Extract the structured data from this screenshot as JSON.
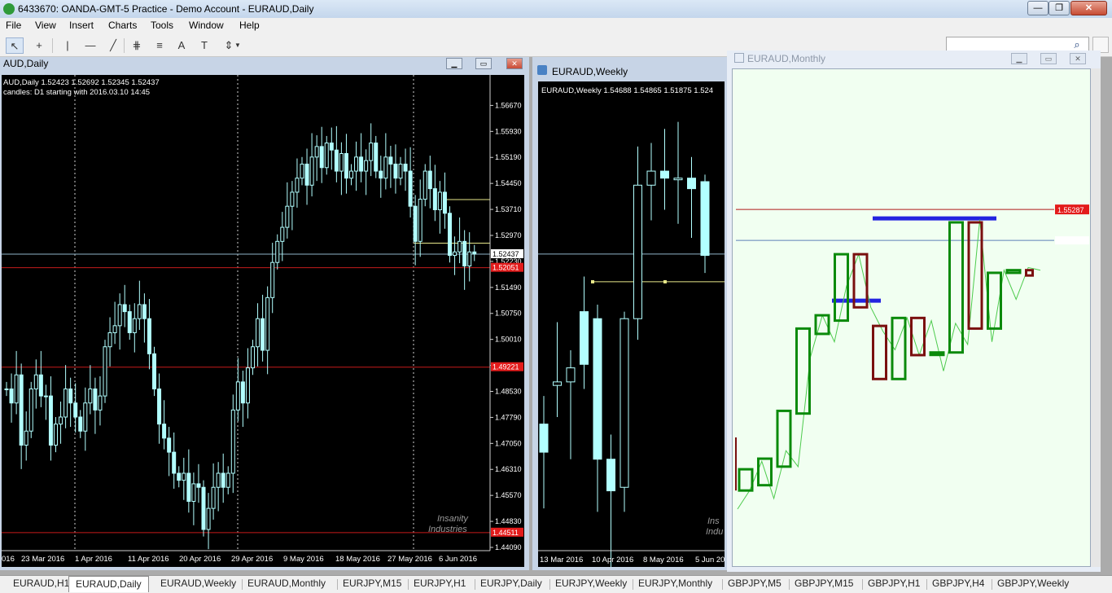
{
  "app": {
    "title": "6433670: OANDA-GMT-5 Practice - Demo Account - EURAUD,Daily",
    "icon": "app-logo-icon",
    "window_buttons": {
      "min": "—",
      "max": "❐",
      "close": "✕"
    }
  },
  "menu": [
    "File",
    "View",
    "Insert",
    "Charts",
    "Tools",
    "Window",
    "Help"
  ],
  "toolbar": {
    "icons": [
      "cursor-icon",
      "crosshair-icon",
      "vertical-line-icon",
      "horizontal-line-icon",
      "trend-line-icon",
      "fibonacci-channel-icon",
      "fibonacci-retracement-icon",
      "text-icon",
      "text-label-icon",
      "arrows-icon"
    ],
    "glyphs": [
      "↖",
      "+",
      "|",
      "—",
      "╱",
      "⋕",
      "≡",
      "A",
      "T",
      "⇕"
    ],
    "search_placeholder": ""
  },
  "windows": {
    "daily": {
      "title": "AUD,Daily",
      "ohlc_line": "AUD,Daily  1.52423 1.52692 1.52345 1.52437",
      "info_line": "candles: D1 starting with 2016.03.10 14:45",
      "watermark_1": "Insanity",
      "watermark_2": "Industries"
    },
    "weekly": {
      "title": "EURAUD,Weekly",
      "ohlc_line": "EURAUD,Weekly  1.54688 1.54865 1.51875 1.524",
      "watermark_1": "Ins",
      "watermark_2": "Indu"
    },
    "monthly": {
      "title": "EURAUD,Monthly",
      "price_label": "1.55287"
    }
  },
  "chart_data": [
    {
      "type": "candlestick",
      "title": "EURAUD,Daily",
      "ylim": [
        1.4409,
        1.5712
      ],
      "y_ticks": [
        "1.56670",
        "1.55930",
        "1.55190",
        "1.54450",
        "1.53710",
        "1.52970",
        "1.52230",
        "1.51490",
        "1.50750",
        "1.50010",
        "1.49270",
        "1.48530",
        "1.47790",
        "1.47050",
        "1.46310",
        "1.45570",
        "1.44830",
        "1.44090"
      ],
      "x_ticks": [
        "016",
        "23 Mar 2016",
        "1 Apr 2016",
        "11 Apr 2016",
        "20 Apr 2016",
        "29 Apr 2016",
        "9 May 2016",
        "18 May 2016",
        "27 May 2016",
        "6 Jun 2016"
      ],
      "price_labels": [
        {
          "value": 1.52437,
          "label": "1.52437",
          "kind": "bid"
        },
        {
          "value": 1.5205,
          "label": "1.52051",
          "kind": "level"
        },
        {
          "value": 1.49221,
          "label": "1.49221",
          "kind": "level"
        },
        {
          "value": 1.44511,
          "label": "1.44511",
          "kind": "level"
        }
      ],
      "horizontal_levels": [
        1.52437,
        1.5205,
        1.49221,
        1.44511
      ],
      "closes": [
        1.486,
        1.482,
        1.49,
        1.47,
        1.474,
        1.486,
        1.49,
        1.484,
        1.484,
        1.47,
        1.476,
        1.478,
        1.486,
        1.482,
        1.478,
        1.474,
        1.482,
        1.486,
        1.48,
        1.484,
        1.498,
        1.502,
        1.504,
        1.51,
        1.508,
        1.502,
        1.506,
        1.51,
        1.506,
        1.496,
        1.486,
        1.476,
        1.472,
        1.468,
        1.462,
        1.46,
        1.462,
        1.454,
        1.459,
        1.458,
        1.446,
        1.452,
        1.458,
        1.462,
        1.458,
        1.462,
        1.48,
        1.488,
        1.482,
        1.492,
        1.498,
        1.506,
        1.497,
        1.512,
        1.522,
        1.528,
        1.532,
        1.538,
        1.542,
        1.546,
        1.55,
        1.544,
        1.552,
        1.555,
        1.549,
        1.556,
        1.554,
        1.548,
        1.553,
        1.546,
        1.548,
        1.552,
        1.548,
        1.551,
        1.556,
        1.548,
        1.546,
        1.552,
        1.55,
        1.546,
        1.55,
        1.548,
        1.538,
        1.528,
        1.54,
        1.548,
        1.543,
        1.537,
        1.542,
        1.536,
        1.524,
        1.525,
        1.528,
        1.521,
        1.525,
        1.5244
      ]
    },
    {
      "type": "candlestick",
      "title": "EURAUD,Weekly",
      "ylim": [
        1.4409,
        1.5712
      ],
      "x_ticks": [
        "13 Mar 2016",
        "10 Apr 2016",
        "8 May 2016",
        "5 Jun 20"
      ],
      "candles": [
        {
          "o": 1.476,
          "h": 1.484,
          "l": 1.452,
          "c": 1.468
        },
        {
          "o": 1.487,
          "h": 1.505,
          "l": 1.478,
          "c": 1.488
        },
        {
          "o": 1.488,
          "h": 1.497,
          "l": 1.466,
          "c": 1.492
        },
        {
          "o": 1.508,
          "h": 1.518,
          "l": 1.486,
          "c": 1.493
        },
        {
          "o": 1.506,
          "h": 1.51,
          "l": 1.451,
          "c": 1.466
        },
        {
          "o": 1.466,
          "h": 1.473,
          "l": 1.433,
          "c": 1.457
        },
        {
          "o": 1.458,
          "h": 1.508,
          "l": 1.451,
          "c": 1.506
        },
        {
          "o": 1.506,
          "h": 1.555,
          "l": 1.5,
          "c": 1.544
        },
        {
          "o": 1.544,
          "h": 1.556,
          "l": 1.534,
          "c": 1.548
        },
        {
          "o": 1.548,
          "h": 1.56,
          "l": 1.537,
          "c": 1.546
        },
        {
          "o": 1.546,
          "h": 1.562,
          "l": 1.533,
          "c": 1.546
        },
        {
          "o": 1.546,
          "h": 1.552,
          "l": 1.529,
          "c": 1.543
        },
        {
          "o": 1.545,
          "h": 1.547,
          "l": 1.519,
          "c": 1.524
        }
      ],
      "horizontal_levels": [
        1.5244,
        1.5165
      ]
    },
    {
      "type": "candlestick",
      "title": "EURAUD,Monthly",
      "ylim": [
        1.44,
        1.575
      ],
      "price_labels": [
        {
          "value": 1.55287,
          "label": "1.55287"
        }
      ],
      "horizontal_levels": [
        1.55287,
        1.5412
      ],
      "candles": [
        {
          "o": 1.447,
          "c": 1.455,
          "dir": "up"
        },
        {
          "o": 1.449,
          "c": 1.459,
          "dir": "up"
        },
        {
          "o": 1.456,
          "c": 1.477,
          "dir": "up"
        },
        {
          "o": 1.476,
          "c": 1.508,
          "dir": "up"
        },
        {
          "o": 1.506,
          "c": 1.513,
          "dir": "up"
        },
        {
          "o": 1.511,
          "c": 1.536,
          "dir": "up"
        },
        {
          "o": 1.536,
          "c": 1.516,
          "dir": "down"
        },
        {
          "o": 1.509,
          "c": 1.489,
          "dir": "down"
        },
        {
          "o": 1.489,
          "c": 1.512,
          "dir": "up"
        },
        {
          "o": 1.512,
          "c": 1.498,
          "dir": "down"
        },
        {
          "o": 1.499,
          "c": 1.499,
          "dir": "up"
        },
        {
          "o": 1.499,
          "c": 1.548,
          "dir": "up"
        },
        {
          "o": 1.548,
          "c": 1.508,
          "dir": "down"
        },
        {
          "o": 1.508,
          "c": 1.529,
          "dir": "up"
        },
        {
          "o": 1.529,
          "c": 1.53,
          "dir": "up"
        },
        {
          "o": 1.53,
          "c": 1.528,
          "dir": "down"
        }
      ],
      "zigzag": [
        1.44,
        1.447,
        1.458,
        1.444,
        1.462,
        1.456,
        1.497,
        1.513,
        1.503,
        1.524,
        1.536,
        1.516,
        1.507,
        1.5,
        1.512,
        1.498,
        1.511,
        1.492,
        1.51,
        1.502,
        1.549,
        1.503,
        1.53,
        1.519,
        1.531,
        1.53
      ]
    }
  ],
  "tabs": [
    "EURAUD,H1",
    "EURAUD,Daily",
    "EURAUD,Weekly",
    "EURAUD,Monthly",
    "EURJPY,M15",
    "EURJPY,H1",
    "EURJPY,Daily",
    "EURJPY,Weekly",
    "EURJPY,Monthly",
    "GBPJPY,M5",
    "GBPJPY,M15",
    "GBPJPY,H1",
    "GBPJPY,H4",
    "GBPJPY,Weekly"
  ],
  "active_tab": 1,
  "colors": {
    "bull_candle": "#b2ffff",
    "level_line": "#c51b1b",
    "bid_line": "#8fb4c9",
    "monthly_up": "#0b8a0b",
    "monthly_down": "#7a0f0f",
    "monthly_zigzag": "#4ecb4e"
  }
}
